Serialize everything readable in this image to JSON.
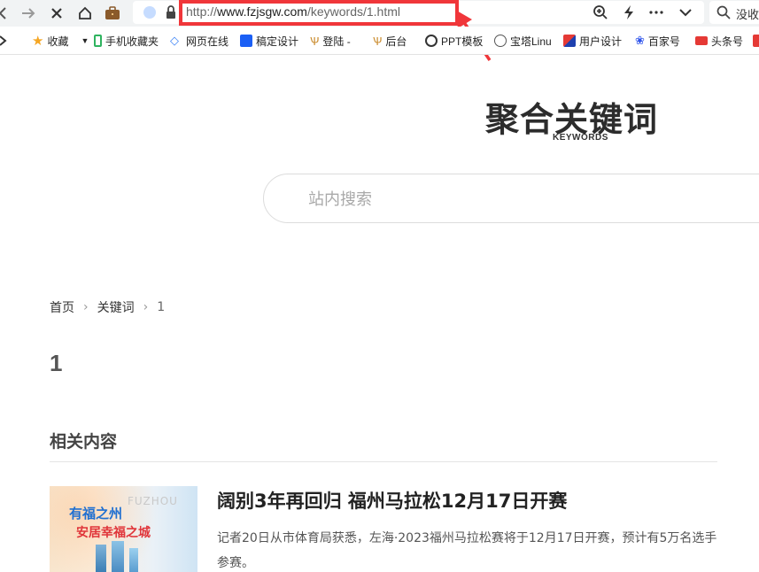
{
  "browser": {
    "url_prefix": "http://",
    "url_host": "www.fzjsgw.com",
    "url_path": "/keywords/1.html",
    "search_placeholder": "没收"
  },
  "bookmarks": [
    {
      "label": "收藏",
      "icon": "star-icon",
      "color": "#f5a623"
    },
    {
      "label": "手机收藏夹",
      "icon": "phone-icon",
      "color": "#2fb35f"
    },
    {
      "label": "网页在线",
      "icon": "web-icon",
      "color": "#3b82f6"
    },
    {
      "label": "稿定设计",
      "icon": "gaoding-icon",
      "color": "#1b5ff5"
    },
    {
      "label": "登陆 -",
      "icon": "antler-icon",
      "color": "#c98a2a"
    },
    {
      "label": "后台",
      "icon": "antler-icon",
      "color": "#c98a2a"
    },
    {
      "label": "PPT模板",
      "icon": "panda-icon",
      "color": "#333333"
    },
    {
      "label": "宝塔Linu",
      "icon": "globe-icon",
      "color": "#555555"
    },
    {
      "label": "用户设计",
      "icon": "flag-icon",
      "color": "#e53935"
    },
    {
      "label": "百家号",
      "icon": "paw-icon",
      "color": "#2f54eb"
    },
    {
      "label": "头条号",
      "icon": "toutiao-icon",
      "color": "#e53935"
    }
  ],
  "site": {
    "logo_cn": "聚合关键词",
    "logo_en": "KEYWORDS",
    "search_placeholder": "站内搜索"
  },
  "breadcrumb": {
    "home": "首页",
    "section": "关键词",
    "current": "1"
  },
  "page": {
    "title": "1",
    "related_heading": "相关内容"
  },
  "articles": [
    {
      "title": "阔别3年再回归 福州马拉松12月17日开赛",
      "desc": "记者20日从市体育局获悉，左海·2023福州马拉松赛将于12月17日开赛，预计有5万名选手参赛。",
      "thumb_text_top": "有福之州",
      "thumb_text_bottom": "安居幸福之城",
      "thumb_watermark": "FUZHOU"
    }
  ],
  "colors": {
    "highlight": "#f0363a",
    "toolbar_bg": "#f1f3f4"
  }
}
